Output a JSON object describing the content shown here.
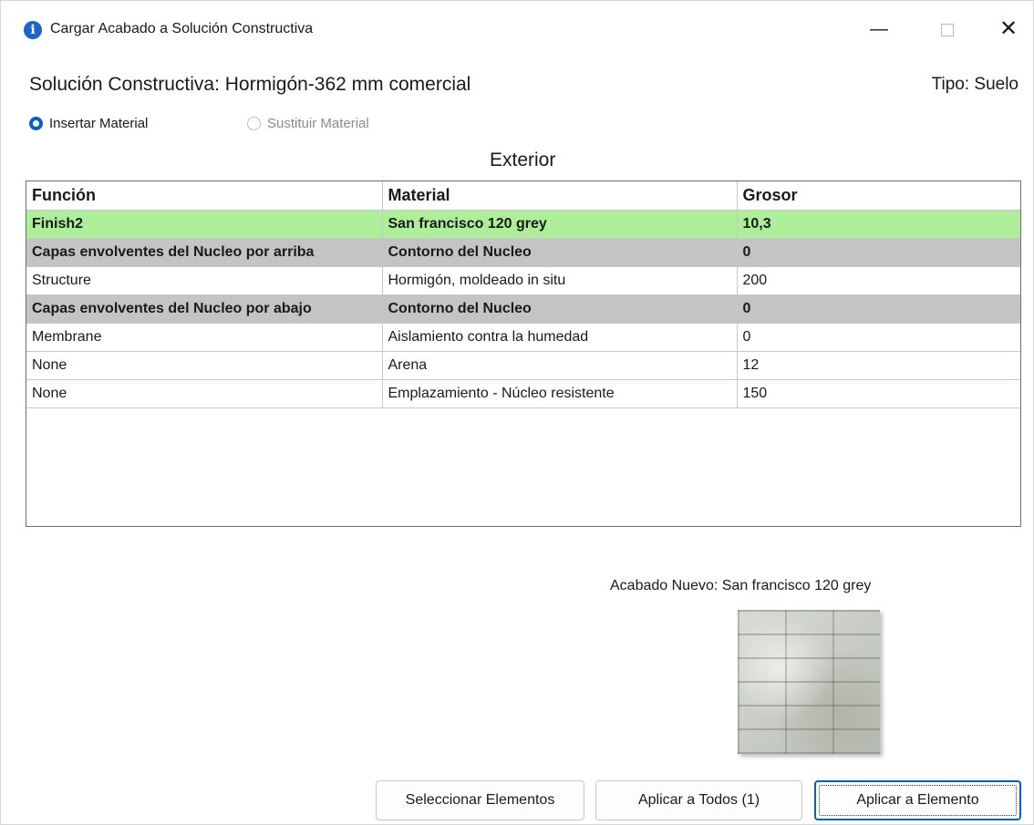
{
  "window": {
    "title": "Cargar Acabado a Solución Constructiva",
    "icon": "info-icon",
    "minimize": "—",
    "close": "✕"
  },
  "header": {
    "solucion": "Solución Constructiva: Hormigón-362 mm comercial",
    "tipo": "Tipo: Suelo"
  },
  "options": {
    "insertar": "Insertar Material",
    "sustituir": "Sustituir Material"
  },
  "grid": {
    "caption": "Exterior",
    "columns": [
      "Función",
      "Material",
      "Grosor"
    ],
    "rows": [
      {
        "funcion": "Finish2",
        "material": "San francisco 120 grey",
        "grosor": "10,3",
        "style": "green"
      },
      {
        "funcion": "Capas envolventes del Nucleo por arriba",
        "material": "Contorno del Nucleo",
        "grosor": "0",
        "style": "gray"
      },
      {
        "funcion": "Structure",
        "material": "Hormigón, moldeado in situ",
        "grosor": "200",
        "style": "plain"
      },
      {
        "funcion": "Capas envolventes del Nucleo por abajo",
        "material": "Contorno del Nucleo",
        "grosor": "0",
        "style": "gray"
      },
      {
        "funcion": "Membrane",
        "material": "Aislamiento contra la humedad",
        "grosor": "0",
        "style": "plain"
      },
      {
        "funcion": "None",
        "material": "Arena",
        "grosor": "12",
        "style": "plain"
      },
      {
        "funcion": "None",
        "material": "Emplazamiento - Núcleo resistente",
        "grosor": "150",
        "style": "plain"
      }
    ]
  },
  "preview": {
    "label": "Acabado Nuevo: San francisco 120 grey"
  },
  "buttons": {
    "select": "Seleccionar Elementos",
    "apply_all": "Aplicar a Todos (1)",
    "apply_element": "Aplicar a Elemento"
  },
  "colors": {
    "highlight_row": "#aeee9a",
    "core_row": "#c4c4c4",
    "accent": "#0a5fc4"
  }
}
